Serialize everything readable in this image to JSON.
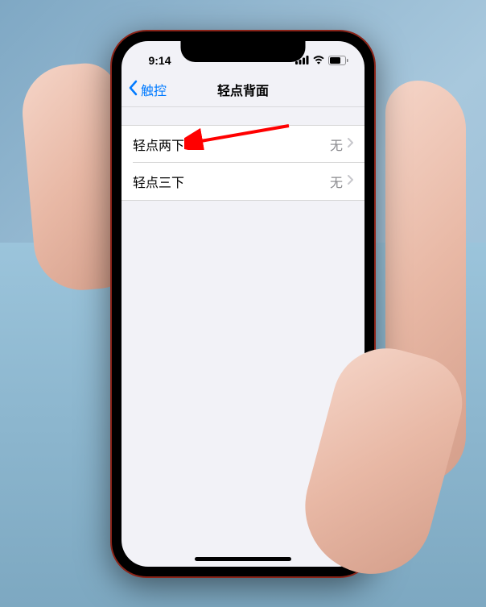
{
  "status": {
    "time": "9:14"
  },
  "nav": {
    "back_label": "触控",
    "title": "轻点背面"
  },
  "rows": {
    "double_tap": {
      "label": "轻点两下",
      "value": "无"
    },
    "triple_tap": {
      "label": "轻点三下",
      "value": "无"
    }
  },
  "icons": {
    "back_chevron_name": "chevron-left-icon",
    "row_chevron_name": "chevron-right-icon"
  }
}
